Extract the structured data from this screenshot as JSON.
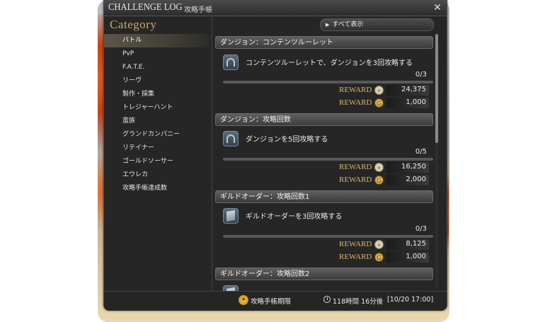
{
  "window": {
    "title": "CHALLENGE LOG",
    "subtitle": "攻略手帳",
    "close_icon": "close-icon"
  },
  "sidebar": {
    "title": "Category",
    "items": [
      {
        "label": "バトル",
        "active": true
      },
      {
        "label": "PvP",
        "active": false
      },
      {
        "label": "F.A.T.E.",
        "active": false
      },
      {
        "label": "リーヴ",
        "active": false
      },
      {
        "label": "製作・採集",
        "active": false
      },
      {
        "label": "トレジャーハント",
        "active": false
      },
      {
        "label": "蛮族",
        "active": false
      },
      {
        "label": "グランドカンパニー",
        "active": false
      },
      {
        "label": "リテイナー",
        "active": false
      },
      {
        "label": "ゴールドソーサー",
        "active": false
      },
      {
        "label": "エウレカ",
        "active": false
      },
      {
        "label": "攻略手帳達成数",
        "active": false
      }
    ]
  },
  "main": {
    "show_all_label": "すべて表示",
    "sections": [
      {
        "header": "ダンジョン：コンテンツルーレット",
        "task": "コンテンツルーレットで、ダンジョンを3回攻略する",
        "icon": "dungeon-icon",
        "progress_text": "0/3",
        "progress": 0,
        "rewards": [
          {
            "label": "REWARD",
            "icon": "experience-icon",
            "value": "24,375"
          },
          {
            "label": "REWARD",
            "icon": "gil-icon",
            "value": "1,000"
          }
        ]
      },
      {
        "header": "ダンジョン：攻略回数",
        "task": "ダンジョンを5回攻略する",
        "icon": "dungeon-icon",
        "progress_text": "0/5",
        "progress": 0,
        "rewards": [
          {
            "label": "REWARD",
            "icon": "experience-icon",
            "value": "16,250"
          },
          {
            "label": "REWARD",
            "icon": "gil-icon",
            "value": "2,000"
          }
        ]
      },
      {
        "header": "ギルドオーダー：攻略回数1",
        "task": "ギルドオーダーを3回攻略する",
        "icon": "guild-order-icon",
        "progress_text": "0/3",
        "progress": 0,
        "rewards": [
          {
            "label": "REWARD",
            "icon": "experience-icon",
            "value": "8,125"
          },
          {
            "label": "REWARD",
            "icon": "gil-icon",
            "value": "1,000"
          }
        ]
      },
      {
        "header": "ギルドオーダー：攻略回数2"
      }
    ]
  },
  "footer": {
    "deadline_label": "攻略手帳期限",
    "time_remaining": "118時間 16分後",
    "deadline_datetime": "[10/20 17:00]"
  },
  "colors": {
    "accent_gold": "#d8b76e",
    "window_bg": "#262626"
  }
}
